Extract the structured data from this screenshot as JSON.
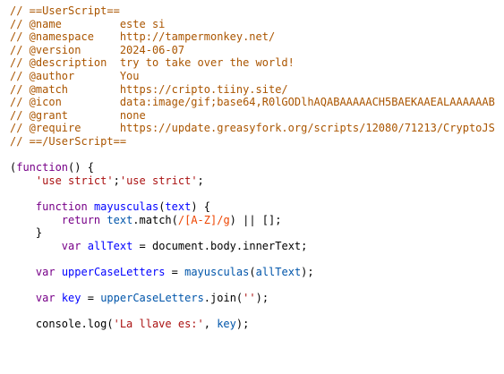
{
  "theme": {
    "background": "#ffffff",
    "comment": "#aa5500",
    "string": "#aa1111",
    "keyword": "#770088",
    "definition": "#0000ff",
    "variable": "#0055aa",
    "regex": "#ee4400",
    "plain": "#000000"
  },
  "code": {
    "lines": [
      [
        {
          "t": "// ==UserScript==",
          "c": "comment"
        }
      ],
      [
        {
          "t": "// @name         este si",
          "c": "comment"
        }
      ],
      [
        {
          "t": "// @namespace    http://tampermonkey.net/",
          "c": "comment"
        }
      ],
      [
        {
          "t": "// @version      2024-06-07",
          "c": "comment"
        }
      ],
      [
        {
          "t": "// @description  try to take over the world!",
          "c": "comment"
        }
      ],
      [
        {
          "t": "// @author       You",
          "c": "comment"
        }
      ],
      [
        {
          "t": "// @match        https://cripto.tiiny.site/",
          "c": "comment"
        }
      ],
      [
        {
          "t": "// @icon         data:image/gif;base64,R0lGODlhAQABAAAAACH5BAEKAAEALAAAAAAB",
          "c": "comment"
        }
      ],
      [
        {
          "t": "// @grant        none",
          "c": "comment"
        }
      ],
      [
        {
          "t": "// @require      https://update.greasyfork.org/scripts/12080/71213/CryptoJS",
          "c": "comment"
        }
      ],
      [
        {
          "t": "// ==/UserScript==",
          "c": "comment"
        }
      ],
      [],
      [
        {
          "t": "(",
          "c": "plain"
        },
        {
          "t": "function",
          "c": "keyword"
        },
        {
          "t": "() {",
          "c": "plain"
        }
      ],
      [
        {
          "t": "    ",
          "c": "plain"
        },
        {
          "t": "'use strict'",
          "c": "string"
        },
        {
          "t": ";",
          "c": "plain"
        },
        {
          "t": "'use strict'",
          "c": "string"
        },
        {
          "t": ";",
          "c": "plain"
        }
      ],
      [],
      [
        {
          "t": "    ",
          "c": "plain"
        },
        {
          "t": "function",
          "c": "keyword"
        },
        {
          "t": " ",
          "c": "plain"
        },
        {
          "t": "mayusculas",
          "c": "def"
        },
        {
          "t": "(",
          "c": "plain"
        },
        {
          "t": "text",
          "c": "def"
        },
        {
          "t": ") {",
          "c": "plain"
        }
      ],
      [
        {
          "t": "        ",
          "c": "plain"
        },
        {
          "t": "return",
          "c": "keyword"
        },
        {
          "t": " ",
          "c": "plain"
        },
        {
          "t": "text",
          "c": "var"
        },
        {
          "t": ".match(",
          "c": "plain"
        },
        {
          "t": "/[A-Z]/g",
          "c": "regex"
        },
        {
          "t": ") || [];",
          "c": "plain"
        }
      ],
      [
        {
          "t": "    }",
          "c": "plain"
        }
      ],
      [
        {
          "t": "        ",
          "c": "plain"
        },
        {
          "t": "var",
          "c": "keyword"
        },
        {
          "t": " ",
          "c": "plain"
        },
        {
          "t": "allText",
          "c": "def"
        },
        {
          "t": " = document.body.innerText;",
          "c": "plain"
        }
      ],
      [],
      [
        {
          "t": "    ",
          "c": "plain"
        },
        {
          "t": "var",
          "c": "keyword"
        },
        {
          "t": " ",
          "c": "plain"
        },
        {
          "t": "upperCaseLetters",
          "c": "def"
        },
        {
          "t": " = ",
          "c": "plain"
        },
        {
          "t": "mayusculas",
          "c": "var"
        },
        {
          "t": "(",
          "c": "plain"
        },
        {
          "t": "allText",
          "c": "var"
        },
        {
          "t": ");",
          "c": "plain"
        }
      ],
      [],
      [
        {
          "t": "    ",
          "c": "plain"
        },
        {
          "t": "var",
          "c": "keyword"
        },
        {
          "t": " ",
          "c": "plain"
        },
        {
          "t": "key",
          "c": "def"
        },
        {
          "t": " = ",
          "c": "plain"
        },
        {
          "t": "upperCaseLetters",
          "c": "var"
        },
        {
          "t": ".join(",
          "c": "plain"
        },
        {
          "t": "''",
          "c": "string"
        },
        {
          "t": ");",
          "c": "plain"
        }
      ],
      [],
      [
        {
          "t": "    console.log(",
          "c": "plain"
        },
        {
          "t": "'La llave es:'",
          "c": "string"
        },
        {
          "t": ", ",
          "c": "plain"
        },
        {
          "t": "key",
          "c": "var"
        },
        {
          "t": ");",
          "c": "plain"
        }
      ]
    ]
  }
}
